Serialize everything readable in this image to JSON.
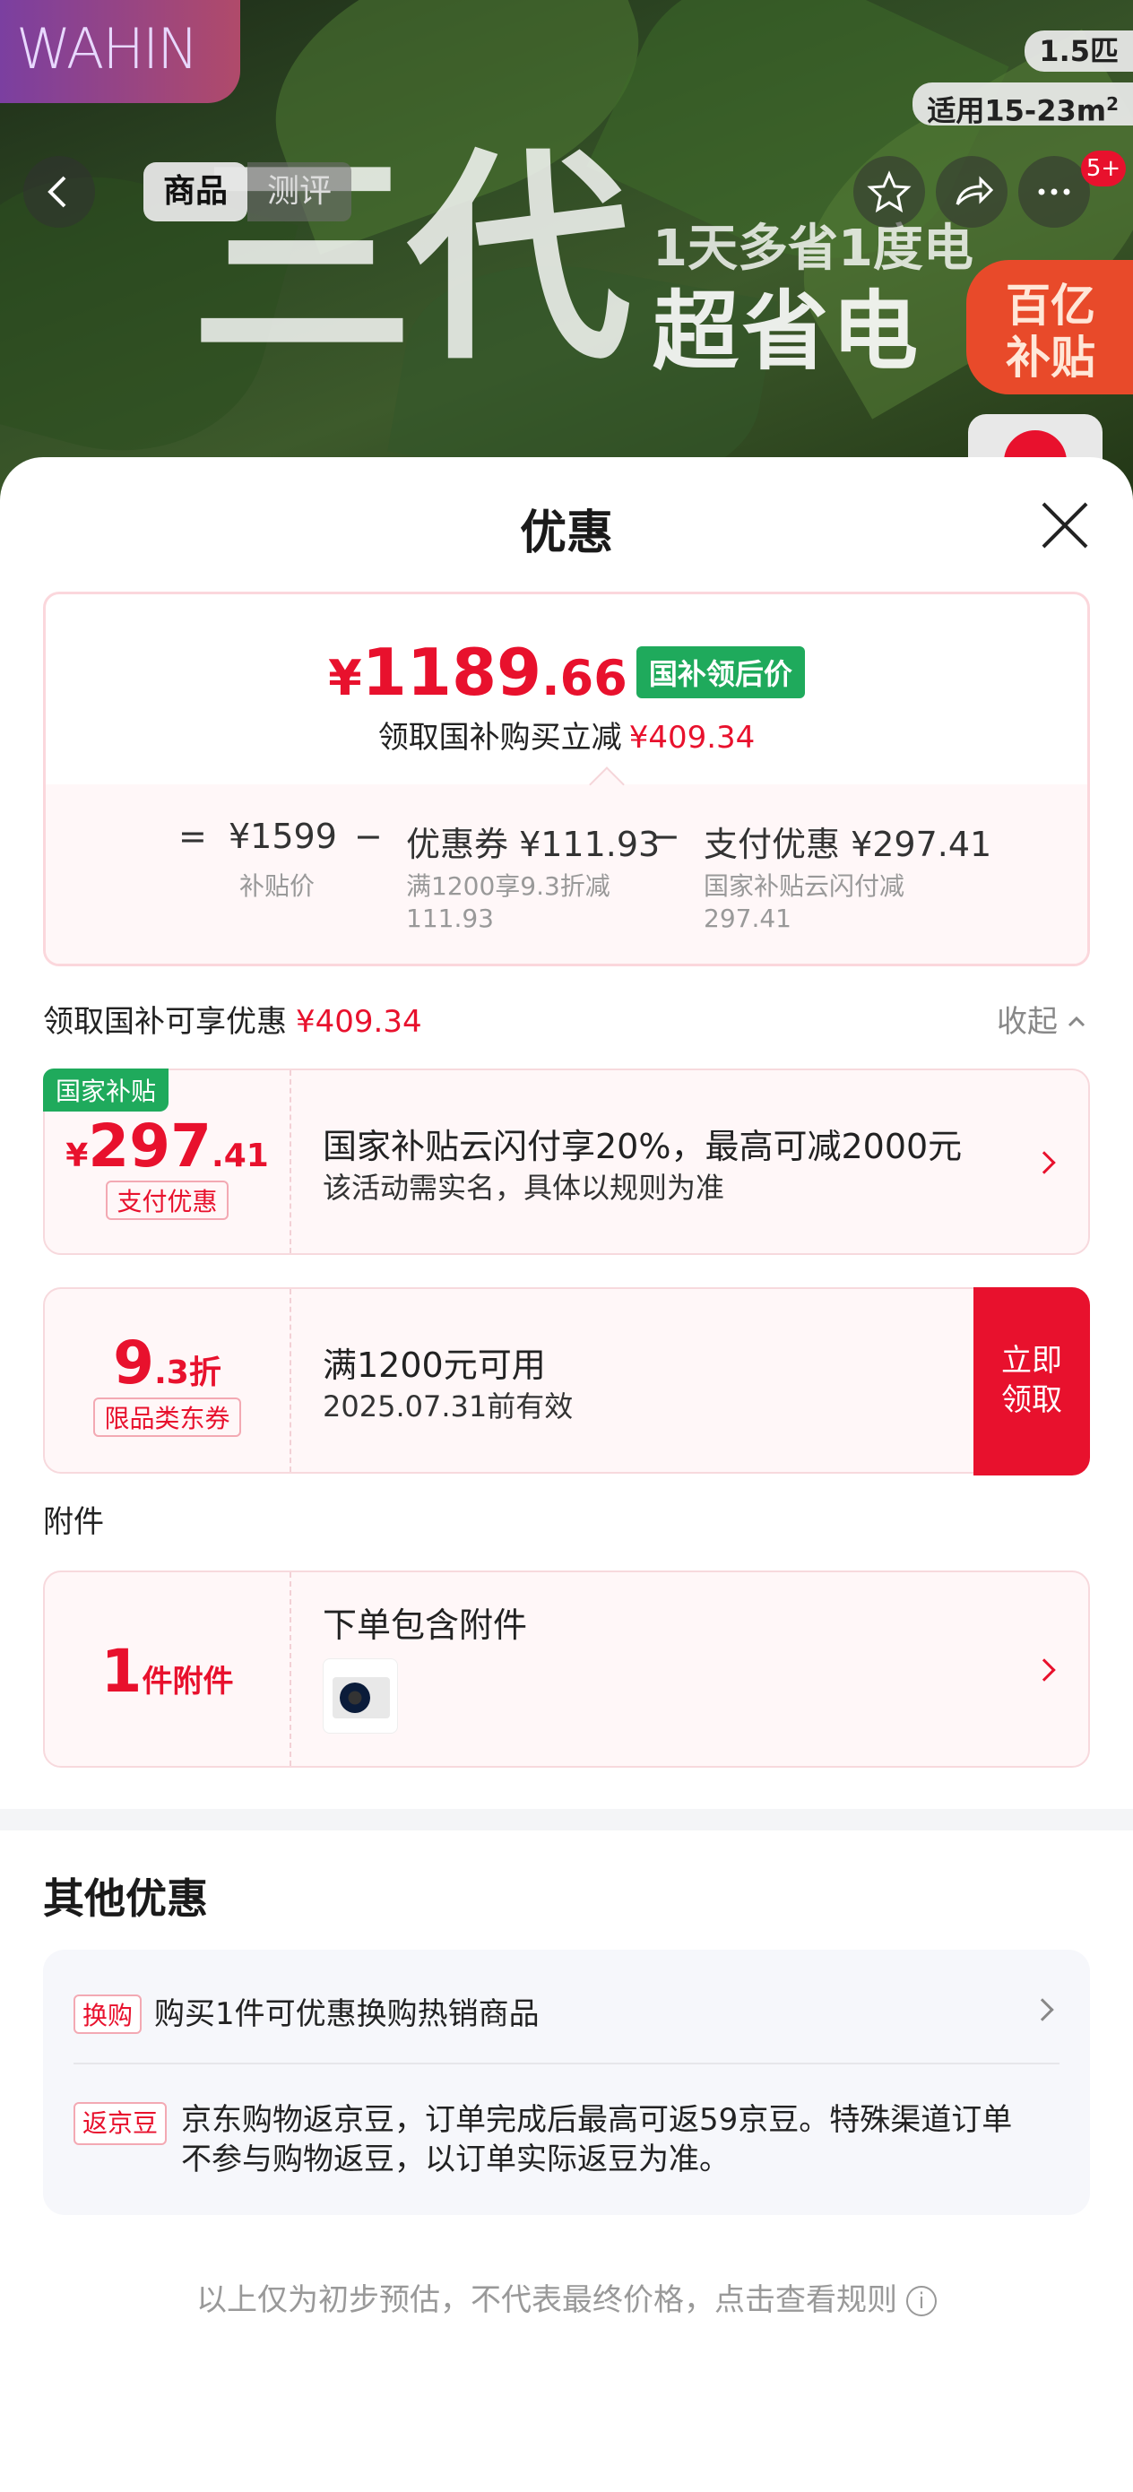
{
  "hero": {
    "brand_logo": "WAHIN",
    "spec_power": "1.5匹",
    "spec_area_prefix": "适用15-23m",
    "spec_area_sup": "2",
    "big_title": "三代",
    "slogan_line1": "1天多省1度电",
    "slogan_line2": "超省电",
    "subsidy_badge_line1": "百亿",
    "subsidy_badge_line2": "补贴",
    "notification_count": "5+",
    "tabs": [
      "商品",
      "测评"
    ]
  },
  "sheet": {
    "title": "优惠",
    "price_card": {
      "currency": "¥",
      "price_int": "1189",
      "price_dec": ".66",
      "price_tag": "国补领后价",
      "subtitle": "领取国补购买立减",
      "subtitle_amount": "¥409.34",
      "eq": "=",
      "minus": "−",
      "base_price": "¥1599",
      "base_label": "补贴价",
      "coupon": "优惠券 ¥111.93",
      "coupon_desc_1": "满1200享9.3折减",
      "coupon_desc_2": "111.93",
      "pay": "支付优惠 ¥297.41",
      "pay_desc_1": "国家补贴云闪付减",
      "pay_desc_2": "297.41"
    },
    "section": {
      "label": "领取国补可享优惠",
      "amount": "¥409.34",
      "collapse": "收起"
    },
    "offers": [
      {
        "tag": "国家补贴",
        "currency": "¥",
        "amount_int": "297",
        "amount_dec": ".41",
        "label": "支付优惠",
        "title": "国家补贴云闪付享20%，最高可减2000元",
        "desc": "该活动需实名，具体以规则为准"
      },
      {
        "amount_int": "9",
        "amount_dec": ".3折",
        "label": "限品类东券",
        "title": "满1200元可用",
        "desc": "2025.07.31前有效",
        "claim_line1": "立即",
        "claim_line2": "领取"
      }
    ],
    "accessory_section": "附件",
    "accessory": {
      "count": "1",
      "unit": "件附件",
      "title": "下单包含附件"
    },
    "other_title": "其他优惠",
    "other": [
      {
        "tag": "换购",
        "text": "购买1件可优惠换购热销商品"
      },
      {
        "tag": "返京豆",
        "text": "京东购物返京豆，订单完成后最高可返59京豆。特殊渠道订单不参与购物返豆，以订单实际返豆为准。"
      }
    ],
    "footer": "以上仅为初步预估，不代表最终价格，点击查看规则",
    "colors": {
      "accent": "#e8112d",
      "green": "#1faa5c"
    }
  }
}
